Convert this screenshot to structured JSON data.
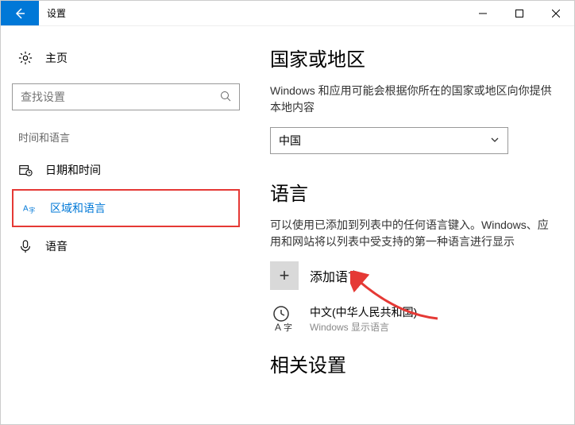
{
  "window": {
    "title": "设置"
  },
  "sidebar": {
    "home_label": "主页",
    "search_placeholder": "查找设置",
    "section_label": "时间和语言",
    "items": [
      {
        "label": "日期和时间"
      },
      {
        "label": "区域和语言"
      },
      {
        "label": "语音"
      }
    ]
  },
  "main": {
    "region_heading": "国家或地区",
    "region_desc": "Windows 和应用可能会根据你所在的国家或地区向你提供本地内容",
    "region_value": "中国",
    "language_heading": "语言",
    "language_desc": "可以使用已添加到列表中的任何语言键入。Windows、应用和网站将以列表中受支持的第一种语言进行显示",
    "add_language_label": "添加语言",
    "languages": [
      {
        "name": "中文(中华人民共和国)",
        "sub": "Windows 显示语言"
      }
    ],
    "related_heading": "相关设置"
  }
}
